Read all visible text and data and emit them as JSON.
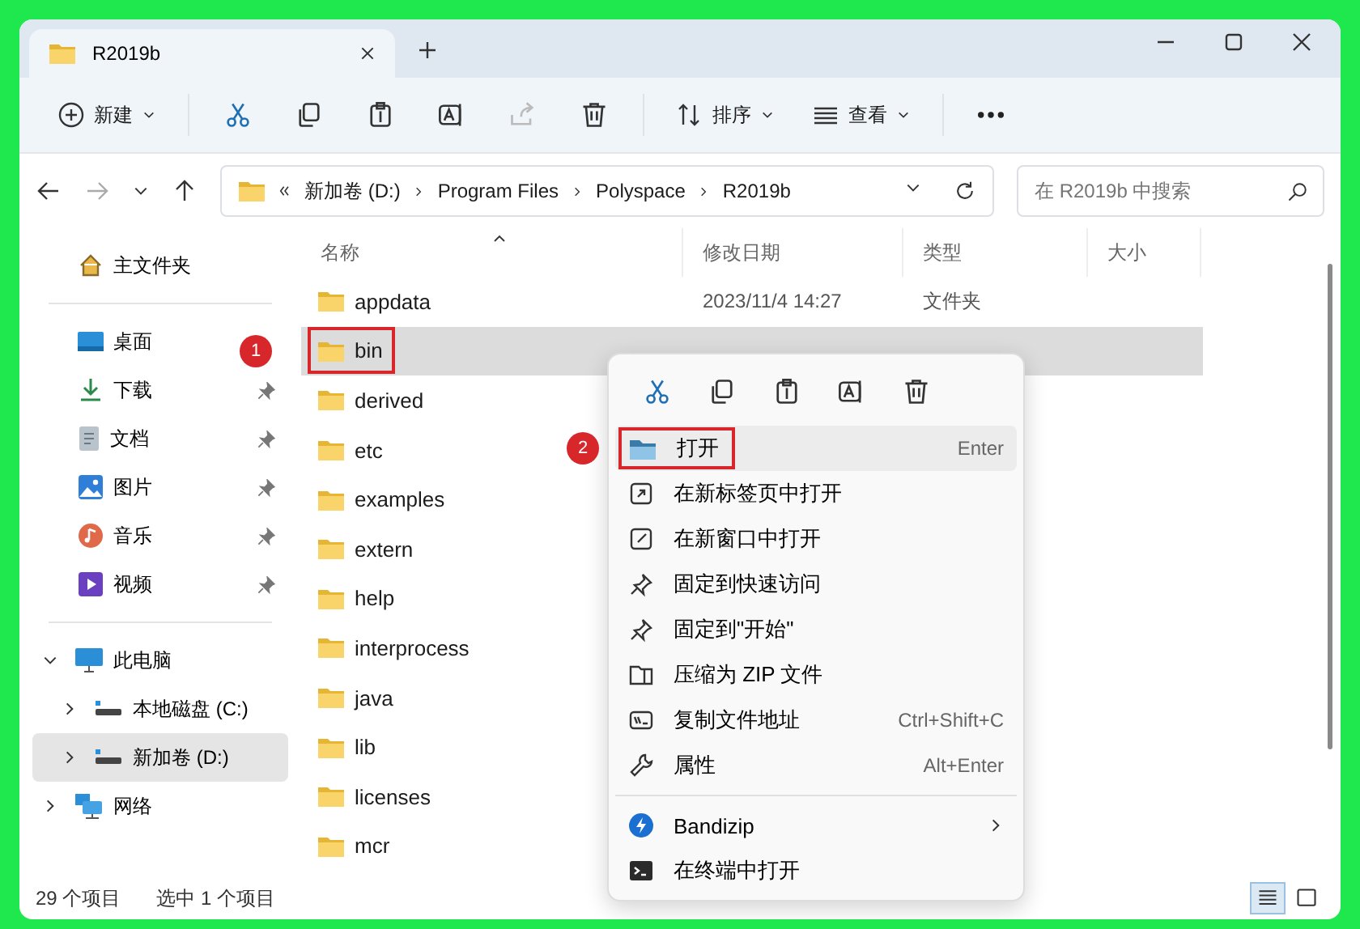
{
  "window": {
    "tab_title": "R2019b"
  },
  "toolbar": {
    "new_label": "新建",
    "sort_label": "排序",
    "view_label": "查看",
    "icon_buttons": [
      {
        "kind": "cut",
        "disabled": false
      },
      {
        "kind": "copy",
        "disabled": false
      },
      {
        "kind": "paste",
        "disabled": false
      },
      {
        "kind": "rename",
        "disabled": false
      },
      {
        "kind": "share",
        "disabled": true
      },
      {
        "kind": "delete",
        "disabled": false
      }
    ]
  },
  "address": {
    "breadcrumbs": [
      "新加卷 (D:)",
      "Program Files",
      "Polyspace",
      "R2019b"
    ],
    "search_placeholder": "在 R2019b 中搜索"
  },
  "nav": {
    "home": "主文件夹",
    "quick_access": [
      {
        "label": "桌面",
        "kind": "desktop",
        "pinned": false
      },
      {
        "label": "下载",
        "kind": "downloads",
        "pinned": true
      },
      {
        "label": "文档",
        "kind": "documents",
        "pinned": true
      },
      {
        "label": "图片",
        "kind": "pictures",
        "pinned": true
      },
      {
        "label": "音乐",
        "kind": "music",
        "pinned": true
      },
      {
        "label": "视频",
        "kind": "videos",
        "pinned": true
      }
    ],
    "tree": [
      {
        "label": "此电脑",
        "kind": "pc",
        "expanded": true,
        "selected": false,
        "children": [
          {
            "label": "本地磁盘 (C:)",
            "kind": "drive",
            "expanded": false,
            "selected": false
          },
          {
            "label": "新加卷 (D:)",
            "kind": "drive",
            "expanded": false,
            "selected": true
          }
        ]
      },
      {
        "label": "网络",
        "kind": "network",
        "expanded": false,
        "selected": false
      }
    ]
  },
  "columns": [
    "名称",
    "修改日期",
    "类型",
    "大小"
  ],
  "rows": [
    {
      "name": "appdata",
      "modified": "2023/11/4 14:27",
      "type": "文件夹",
      "selected": false
    },
    {
      "name": "bin",
      "selected": true,
      "annotation": "1"
    },
    {
      "name": "derived",
      "selected": false
    },
    {
      "name": "etc",
      "selected": false
    },
    {
      "name": "examples",
      "selected": false
    },
    {
      "name": "extern",
      "selected": false
    },
    {
      "name": "help",
      "selected": false
    },
    {
      "name": "interprocess",
      "selected": false
    },
    {
      "name": "java",
      "selected": false
    },
    {
      "name": "lib",
      "selected": false
    },
    {
      "name": "licenses",
      "selected": false
    },
    {
      "name": "mcr",
      "selected": false
    }
  ],
  "context_menu": {
    "quick_actions": [
      {
        "kind": "cut"
      },
      {
        "kind": "copy"
      },
      {
        "kind": "paste"
      },
      {
        "kind": "rename"
      },
      {
        "kind": "delete"
      }
    ],
    "groups": [
      [
        {
          "label": "打开",
          "kind": "open",
          "shortcut": "Enter",
          "highlighted": true,
          "annotation": "2"
        },
        {
          "label": "在新标签页中打开",
          "kind": "newtab",
          "highlighted": false
        },
        {
          "label": "在新窗口中打开",
          "kind": "newwindow",
          "highlighted": false
        },
        {
          "label": "固定到快速访问",
          "kind": "pin",
          "highlighted": false
        },
        {
          "label": "固定到\"开始\"",
          "kind": "pin",
          "highlighted": false
        },
        {
          "label": "压缩为 ZIP 文件",
          "kind": "zip",
          "highlighted": false
        },
        {
          "label": "复制文件地址",
          "kind": "path",
          "shortcut": "Ctrl+Shift+C",
          "highlighted": false
        },
        {
          "label": "属性",
          "kind": "properties",
          "shortcut": "Alt+Enter",
          "highlighted": false
        }
      ],
      [
        {
          "label": "Bandizip",
          "kind": "bandizip",
          "submenu": true,
          "highlighted": false
        },
        {
          "label": "在终端中打开",
          "kind": "terminal",
          "highlighted": false
        }
      ]
    ]
  },
  "status": {
    "count": "29 个项目",
    "selection": "选中 1 个项目",
    "views": [
      {
        "kind": "details",
        "selected": true
      },
      {
        "kind": "tiles",
        "selected": false
      }
    ]
  }
}
